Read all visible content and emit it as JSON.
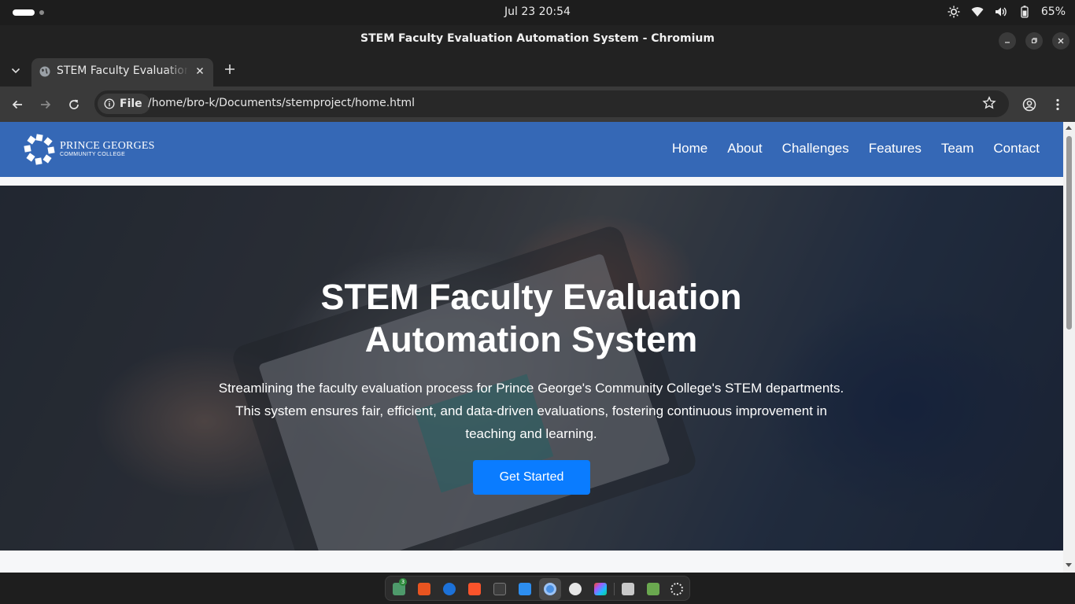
{
  "system": {
    "clock": "Jul 23  20:54",
    "battery": "65%"
  },
  "window": {
    "title": "STEM Faculty Evaluation Automation System - Chromium"
  },
  "tab": {
    "title": "STEM Faculty Evaluation Automation System"
  },
  "address_bar": {
    "scheme_label": "File",
    "url": "/home/bro-k/Documents/stemproject/home.html"
  },
  "site": {
    "logo_line1": "PRINCE GEORGES",
    "logo_line2": "COMMUNITY COLLEGE",
    "nav": [
      "Home",
      "About",
      "Challenges",
      "Features",
      "Team",
      "Contact"
    ],
    "hero": {
      "title_line1": "STEM Faculty Evaluation",
      "title_line2": "Automation System",
      "subtitle": "Streamlining the faculty evaluation process for Prince George's Community College's STEM departments. This system ensures fair, efficient, and data-driven evaluations, fostering continuous improvement in teaching and learning.",
      "cta": "Get Started"
    },
    "colors": {
      "nav_bg": "#3568b6",
      "cta_bg": "#0a7cff"
    }
  },
  "dock": {
    "apps": [
      "files-icon",
      "app-center-icon",
      "help-icon",
      "brave-icon",
      "terminal-icon",
      "vscode-icon",
      "chromium-icon",
      "github-icon",
      "figma-icon",
      "text-editor-icon",
      "trash-icon",
      "show-apps-icon"
    ],
    "files_badge": "3"
  }
}
